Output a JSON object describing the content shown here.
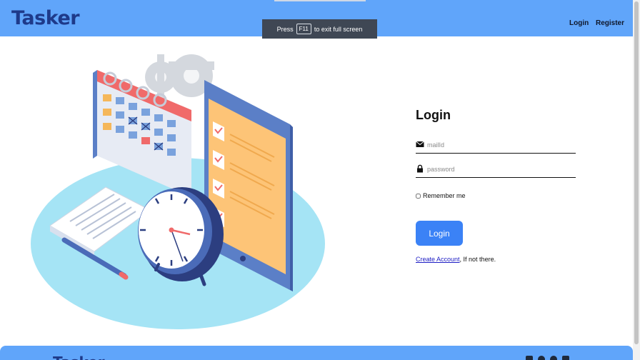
{
  "navbar": {
    "brand": "Tasker",
    "links": {
      "login": "Login",
      "register": "Register"
    }
  },
  "fullscreen_notice": {
    "prefix": "Press",
    "key": "F11",
    "suffix": "to exit full screen"
  },
  "login_form": {
    "title": "Login",
    "email": {
      "placeholder": "mailId",
      "icon": "envelope-icon"
    },
    "password": {
      "placeholder": "password",
      "icon": "lock-icon"
    },
    "remember_label": "Remember me",
    "submit_label": "Login",
    "create_link": "Create Account",
    "create_suffix": ", If not there."
  },
  "footer": {
    "brand": "Tasker",
    "social_icons": [
      "linkedin-icon",
      "github-icon",
      "globe-icon",
      "instagram-icon"
    ]
  },
  "colors": {
    "navbar_bg": "#60a5fa",
    "brand": "#1e3a8a",
    "button": "#3b82f6"
  }
}
